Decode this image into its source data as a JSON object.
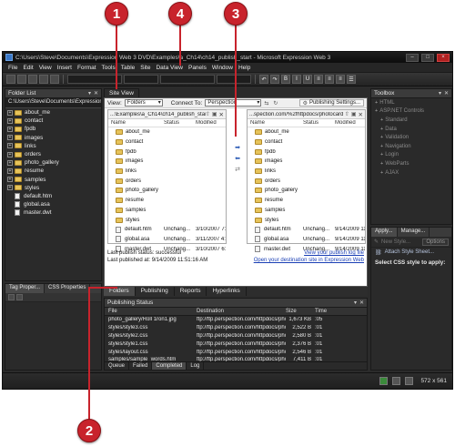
{
  "callouts": [
    "1",
    "4",
    "3",
    "2"
  ],
  "window": {
    "title": "C:\\Users\\Steve\\Documents\\Expression Web 3 DVD\\Examples\\a_Ch14\\ch14_publish_start - Microsoft Expression Web 3"
  },
  "menu": [
    "File",
    "Edit",
    "View",
    "Insert",
    "Format",
    "Tools",
    "Table",
    "Site",
    "Data View",
    "Panels",
    "Window",
    "Help"
  ],
  "folder_list": {
    "title": "Folder List",
    "path": "C:\\Users\\Steve\\Documents\\Expression W",
    "folders": [
      "about_me",
      "contact",
      "fpdb",
      "images",
      "links",
      "orders",
      "photo_gallery",
      "resume",
      "samples",
      "styles"
    ],
    "files": [
      "default.htm",
      "global.asa",
      "master.dwt"
    ]
  },
  "lower_left": {
    "tabs": [
      "Tag Proper...",
      "CSS Properties"
    ]
  },
  "site_view": {
    "tab": "Site View",
    "view_label": "View:",
    "view_value": "Folders",
    "connect_label": "Connect To:",
    "connect_value": "Perspection",
    "publishing_settings": "Publishing Settings...",
    "local_path": "...\\Examples\\a_Ch14\\ch14_publish_start",
    "remote_path": "...spection.com/%2fhttpdocs/photocard",
    "col_name": "Name",
    "col_status": "Status",
    "col_modified": "Modified",
    "local_rows": [
      {
        "name": "about_me",
        "status": "",
        "modified": "",
        "type": "folder"
      },
      {
        "name": "contact",
        "status": "",
        "modified": "",
        "type": "folder"
      },
      {
        "name": "fpdb",
        "status": "",
        "modified": "",
        "type": "folder"
      },
      {
        "name": "images",
        "status": "",
        "modified": "",
        "type": "folder"
      },
      {
        "name": "links",
        "status": "",
        "modified": "",
        "type": "folder"
      },
      {
        "name": "orders",
        "status": "",
        "modified": "",
        "type": "folder"
      },
      {
        "name": "photo_gallery",
        "status": "",
        "modified": "",
        "type": "folder"
      },
      {
        "name": "resume",
        "status": "",
        "modified": "",
        "type": "folder"
      },
      {
        "name": "samples",
        "status": "",
        "modified": "",
        "type": "folder"
      },
      {
        "name": "styles",
        "status": "",
        "modified": "",
        "type": "folder"
      },
      {
        "name": "default.htm",
        "status": "Unchang...",
        "modified": "3/10/2007 7:2",
        "type": "page"
      },
      {
        "name": "global.asa",
        "status": "Unchang...",
        "modified": "3/11/2007 4:0",
        "type": "page"
      },
      {
        "name": "master.dwt",
        "status": "Unchang...",
        "modified": "3/10/2007 6:24",
        "type": "page"
      }
    ],
    "remote_rows": [
      {
        "name": "about_me",
        "status": "",
        "modified": "",
        "type": "folder"
      },
      {
        "name": "contact",
        "status": "",
        "modified": "",
        "type": "folder"
      },
      {
        "name": "fpdb",
        "status": "",
        "modified": "",
        "type": "folder"
      },
      {
        "name": "images",
        "status": "",
        "modified": "",
        "type": "folder"
      },
      {
        "name": "links",
        "status": "",
        "modified": "",
        "type": "folder"
      },
      {
        "name": "orders",
        "status": "",
        "modified": "",
        "type": "folder"
      },
      {
        "name": "photo_gallery",
        "status": "",
        "modified": "",
        "type": "folder"
      },
      {
        "name": "resume",
        "status": "",
        "modified": "",
        "type": "folder"
      },
      {
        "name": "samples",
        "status": "",
        "modified": "",
        "type": "folder"
      },
      {
        "name": "styles",
        "status": "",
        "modified": "",
        "type": "folder"
      },
      {
        "name": "default.htm",
        "status": "Unchang...",
        "modified": "9/14/2009 11:",
        "type": "page"
      },
      {
        "name": "global.asa",
        "status": "Unchang...",
        "modified": "9/14/2009 11:",
        "type": "page"
      },
      {
        "name": "master.dwt",
        "status": "Unchang...",
        "modified": "9/14/2009 11:",
        "type": "page"
      }
    ],
    "last_status": "Last publish status: successful",
    "last_published": "Last published at: 9/14/2009 11:51:16 AM",
    "view_log": "View your publish log file",
    "open_dest": "Open your destination site in Expression Web"
  },
  "view_tabs": [
    "Folders",
    "Publishing",
    "Reports",
    "Hyperlinks"
  ],
  "publishing_status": {
    "title": "Publishing Status",
    "col_file": "File",
    "col_destination": "Destination",
    "col_size": "Size",
    "col_time": "Time",
    "rows": [
      {
        "file": "photo_gallery/Roll 1ron1.jpg",
        "destination": "ftp://ftp.perspection.com/httpdocs/pho",
        "size": "1,673 KB",
        "time": ":05"
      },
      {
        "file": "styles/style3.css",
        "destination": "ftp://ftp.perspection.com/httpdocs/pho",
        "size": "2,522 B",
        "time": ":01"
      },
      {
        "file": "styles/style2.css",
        "destination": "ftp://ftp.perspection.com/httpdocs/pho",
        "size": "2,580 B",
        "time": ":01"
      },
      {
        "file": "styles/style1.css",
        "destination": "ftp://ftp.perspection.com/httpdocs/pho",
        "size": "2,376 B",
        "time": ":01"
      },
      {
        "file": "styles/layout.css",
        "destination": "ftp://ftp.perspection.com/httpdocs/pho",
        "size": "2,546 B",
        "time": ":01"
      },
      {
        "file": "samples/sample_words.htm",
        "destination": "ftp://ftp.perspection.com/httpdocs/pho",
        "size": "7,411 B",
        "time": ":01"
      }
    ],
    "tabs": [
      "Queue",
      "Failed",
      "Completed",
      "Log"
    ]
  },
  "toolbox": {
    "title": "Toolbox",
    "items": [
      "HTML",
      "ASP.NET Controls",
      "Standard",
      "Data",
      "Validation",
      "Navigation",
      "Login",
      "WebParts",
      "AJAX"
    ]
  },
  "apply_styles": {
    "tabs": [
      "Apply...",
      "Manage..."
    ],
    "new_style": "New Style...",
    "options": "Options",
    "attach": "Attach Style Sheet...",
    "select_label": "Select CSS style to apply:"
  },
  "statusbar": {
    "dimensions": "572 x 561"
  }
}
